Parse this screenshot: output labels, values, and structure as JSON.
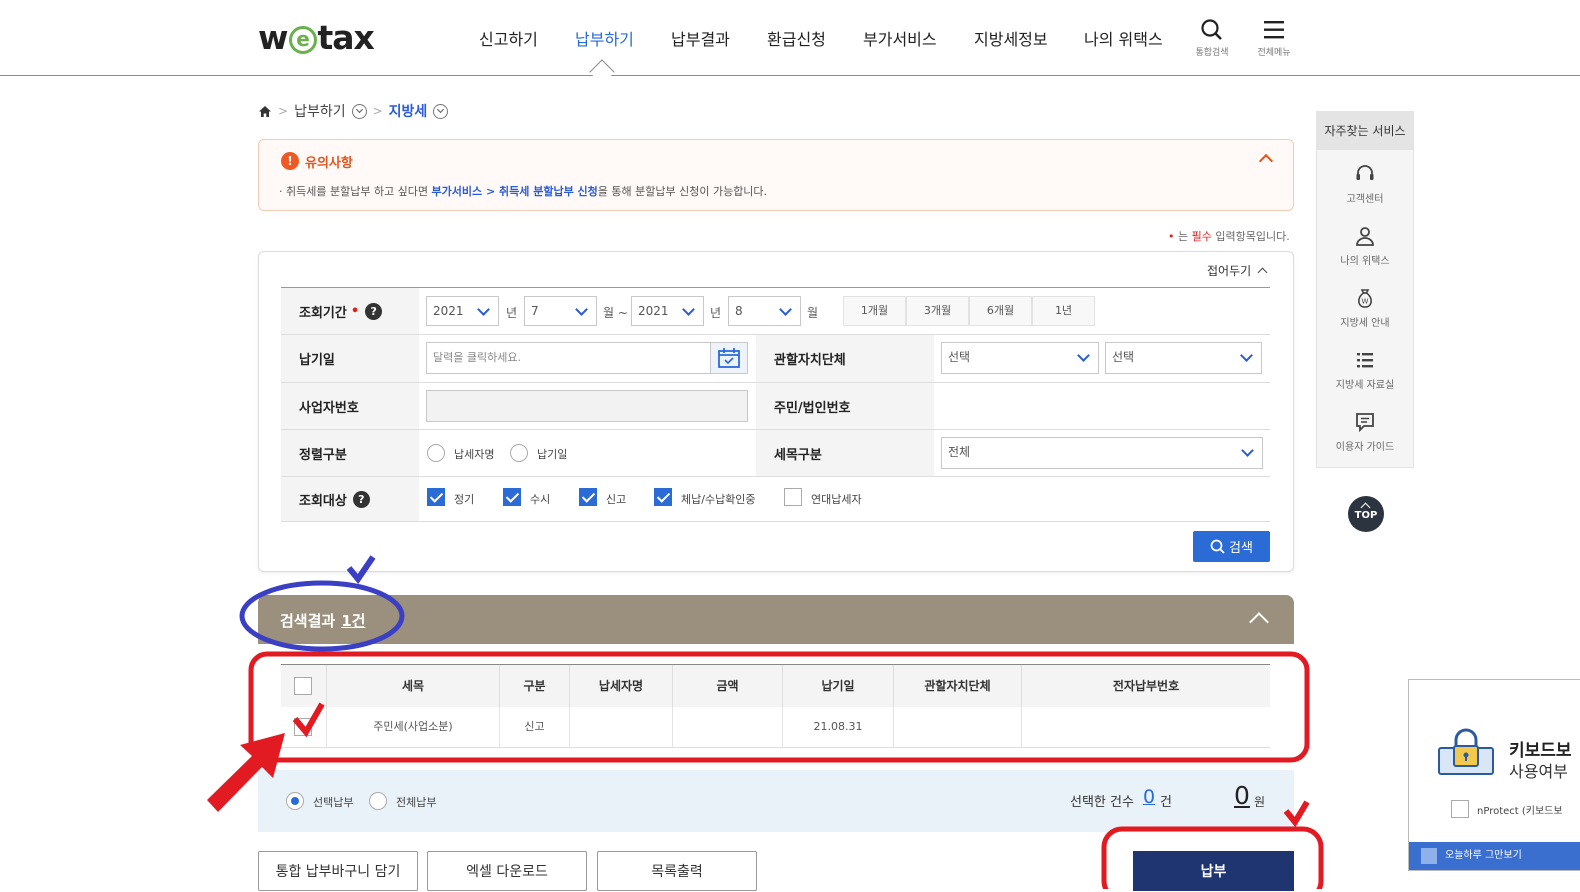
{
  "header": {
    "logo_prefix": "w",
    "logo_e": "e",
    "logo_suffix": "tax",
    "nav": [
      "신고하기",
      "납부하기",
      "납부결과",
      "환급신청",
      "부가서비스",
      "지방세정보",
      "나의 위택스"
    ],
    "search_label": "통합검색",
    "menu_label": "전체메뉴"
  },
  "breadcrumb": {
    "level1": "납부하기",
    "level2": "지방세"
  },
  "notice": {
    "title": "유의사항",
    "text_pre": "· 취득세를 분할납부 하고 싶다면 ",
    "text_link": "부가서비스 > 취득세 분할납부 신청",
    "text_post": "을 통해 분할납부 신청이 가능합니다."
  },
  "required_note": {
    "bullet": "•",
    "pre": " 는 ",
    "word": "필수",
    "post": " 입력항목입니다."
  },
  "search": {
    "collapse_label": "접어두기",
    "period_label": "조회기간",
    "from_year": "2021",
    "from_month": "7",
    "to_year": "2021",
    "to_month": "8",
    "unit_year": "년",
    "unit_month_from": "월 ~",
    "unit_month_to": "월",
    "period_buttons": [
      "1개월",
      "3개월",
      "6개월",
      "1년"
    ],
    "due_date_label": "납기일",
    "due_date_placeholder": "달력을 클릭하세요.",
    "local_gov_label": "관할자치단체",
    "local_gov_select1": "선택",
    "local_gov_select2": "선택",
    "biz_no_label": "사업자번호",
    "resident_no_label": "주민/법인번호",
    "sort_label": "정렬구분",
    "sort_options": [
      "납세자명",
      "납기일"
    ],
    "tax_item_label": "세목구분",
    "tax_item_value": "전체",
    "target_label": "조회대상",
    "targets": [
      {
        "label": "정기",
        "checked": true
      },
      {
        "label": "수시",
        "checked": true
      },
      {
        "label": "신고",
        "checked": true
      },
      {
        "label": "체납/수납확인중",
        "checked": true
      },
      {
        "label": "연대납세자",
        "checked": false
      }
    ],
    "search_button": "검색"
  },
  "results": {
    "title": "검색결과",
    "count": "1건",
    "columns": [
      "세목",
      "구분",
      "납세자명",
      "금액",
      "납기일",
      "관할자치단체",
      "전자납부번호"
    ],
    "rows": [
      {
        "tax_item": "주민세(사업소분)",
        "type": "신고",
        "taxpayer": "",
        "amount": "",
        "due_date": "21.08.31",
        "local_gov": "",
        "e_pay_no": ""
      }
    ]
  },
  "pay_strip": {
    "option_selected": "선택납부",
    "option_all": "전체납부",
    "selected_count_label": "선택한 건수",
    "selected_count": "0",
    "count_unit": "건",
    "total_amount": "0",
    "amount_unit": "원"
  },
  "buttons": {
    "basket": "통합 납부바구니 담기",
    "excel": "엑셀 다운로드",
    "print": "목록출력",
    "pay": "납부"
  },
  "quick_menu": {
    "title": "자주찾는 서비스",
    "items": [
      "고객센터",
      "나의 위택스",
      "지방세 안내",
      "지방세 자료실",
      "이용자 가이드"
    ],
    "top": "TOP"
  },
  "kbd_popup": {
    "title_line1": "키보드보",
    "title_line2": "사용여부",
    "checkbox_label": "nProtect (키보드보",
    "footer": "오늘하루 그만보기"
  },
  "colors": {
    "accent": "#2b6bd6",
    "result_bar": "#9b8f7e",
    "pay_button": "#1f3572",
    "annotation_red": "#e21b23",
    "annotation_blue": "#3a3fc4"
  }
}
